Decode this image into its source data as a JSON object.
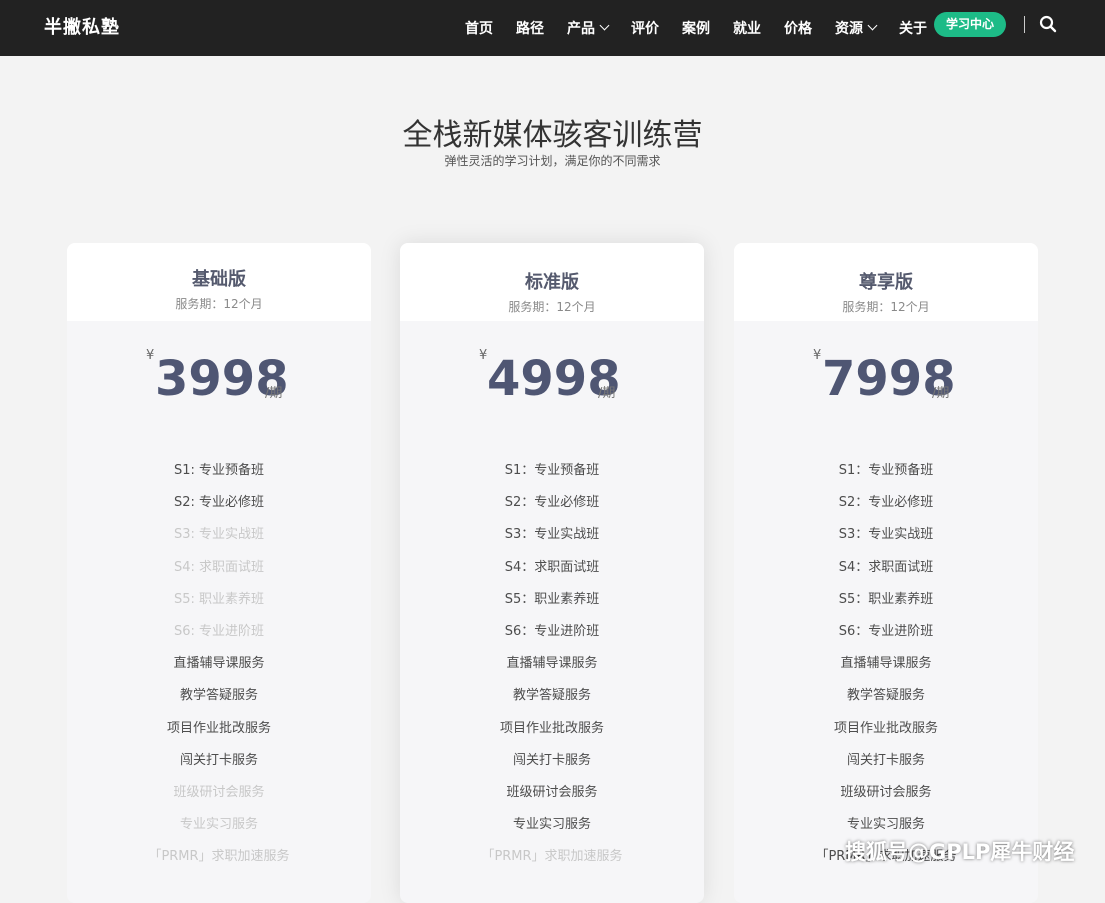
{
  "header": {
    "logo": "半撇私塾",
    "nav": [
      {
        "label": "首页",
        "dropdown": false
      },
      {
        "label": "路径",
        "dropdown": false
      },
      {
        "label": "产品",
        "dropdown": true
      },
      {
        "label": "评价",
        "dropdown": false
      },
      {
        "label": "案例",
        "dropdown": false
      },
      {
        "label": "就业",
        "dropdown": false
      },
      {
        "label": "价格",
        "dropdown": false
      },
      {
        "label": "资源",
        "dropdown": true
      },
      {
        "label": "关于",
        "dropdown": false
      }
    ],
    "cta_label": "学习中心",
    "search_icon": "search-icon"
  },
  "hero": {
    "title": "全栈新媒体骇客训练营",
    "subtitle": "弹性灵活的学习计划，满足你的不同需求"
  },
  "plans": [
    {
      "name": "基础版",
      "period": "服务期：12个月",
      "currency": "¥",
      "price": "3998",
      "per": "/期",
      "features": [
        {
          "label": "S1: 专业预备班",
          "included": true
        },
        {
          "label": "S2: 专业必修班",
          "included": true
        },
        {
          "label": "S3: 专业实战班",
          "included": false
        },
        {
          "label": "S4: 求职面试班",
          "included": false
        },
        {
          "label": "S5: 职业素养班",
          "included": false
        },
        {
          "label": "S6: 专业进阶班",
          "included": false
        },
        {
          "label": "直播辅导课服务",
          "included": true
        },
        {
          "label": "教学答疑服务",
          "included": true
        },
        {
          "label": "项目作业批改服务",
          "included": true
        },
        {
          "label": "闯关打卡服务",
          "included": true
        },
        {
          "label": "班级研讨会服务",
          "included": false
        },
        {
          "label": "专业实习服务",
          "included": false
        },
        {
          "label": "「PRMR」求职加速服务",
          "included": false
        }
      ]
    },
    {
      "name": "标准版",
      "period": "服务期：12个月",
      "currency": "¥",
      "price": "4998",
      "per": "/期",
      "features": [
        {
          "label": "S1：专业预备班",
          "included": true
        },
        {
          "label": "S2：专业必修班",
          "included": true
        },
        {
          "label": "S3：专业实战班",
          "included": true
        },
        {
          "label": "S4：求职面试班",
          "included": true
        },
        {
          "label": "S5：职业素养班",
          "included": true
        },
        {
          "label": "S6：专业进阶班",
          "included": true
        },
        {
          "label": "直播辅导课服务",
          "included": true
        },
        {
          "label": "教学答疑服务",
          "included": true
        },
        {
          "label": "项目作业批改服务",
          "included": true
        },
        {
          "label": "闯关打卡服务",
          "included": true
        },
        {
          "label": "班级研讨会服务",
          "included": true
        },
        {
          "label": "专业实习服务",
          "included": true
        },
        {
          "label": "「PRMR」求职加速服务",
          "included": false
        }
      ]
    },
    {
      "name": "尊享版",
      "period": "服务期：12个月",
      "currency": "¥",
      "price": "7998",
      "per": "/期",
      "features": [
        {
          "label": "S1：专业预备班",
          "included": true
        },
        {
          "label": "S2：专业必修班",
          "included": true
        },
        {
          "label": "S3：专业实战班",
          "included": true
        },
        {
          "label": "S4：求职面试班",
          "included": true
        },
        {
          "label": "S5：职业素养班",
          "included": true
        },
        {
          "label": "S6：专业进阶班",
          "included": true
        },
        {
          "label": "直播辅导课服务",
          "included": true
        },
        {
          "label": "教学答疑服务",
          "included": true
        },
        {
          "label": "项目作业批改服务",
          "included": true
        },
        {
          "label": "闯关打卡服务",
          "included": true
        },
        {
          "label": "班级研讨会服务",
          "included": true
        },
        {
          "label": "专业实习服务",
          "included": true
        },
        {
          "label": "「PRMR」求职加速服务",
          "included": true
        }
      ]
    }
  ],
  "watermark": "搜狐号@GPLP犀牛财经",
  "colors": {
    "nav_bg": "#222222",
    "accent": "#1dbb87",
    "price": "#4f5673",
    "page_bg": "#f3f3f3"
  }
}
